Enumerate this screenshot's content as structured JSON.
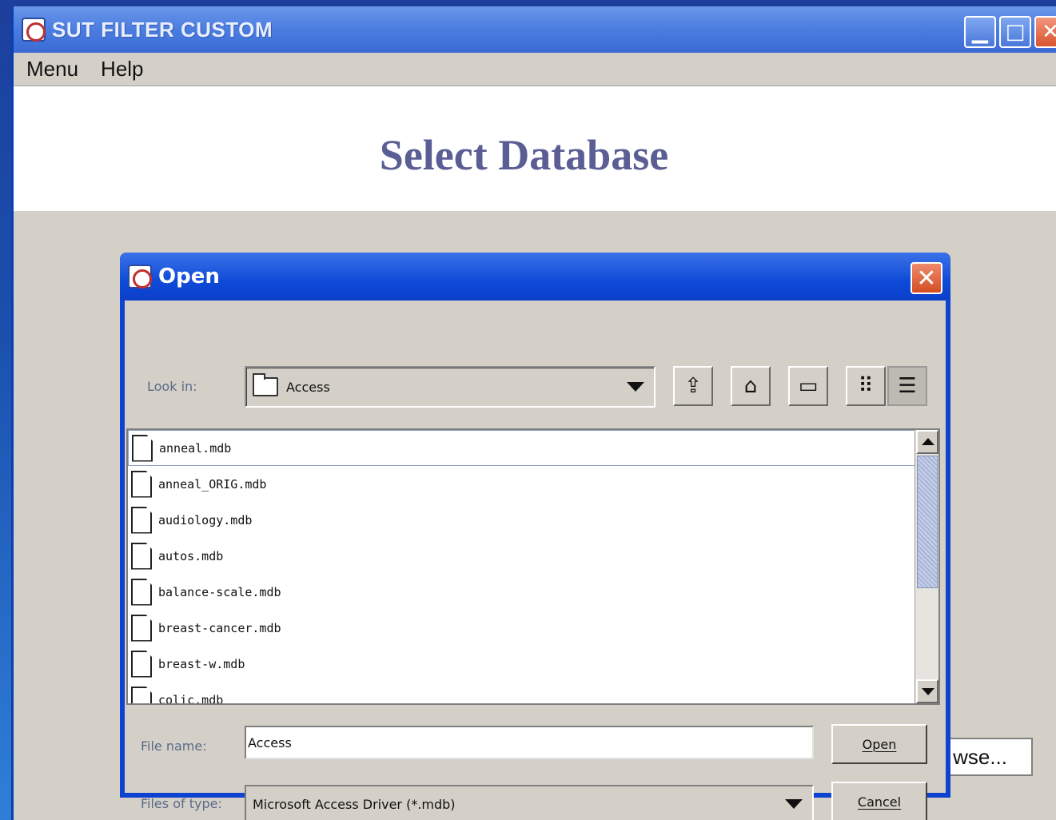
{
  "main_window": {
    "title": "SUT FILTER CUSTOM",
    "controls": {
      "minimize": "▁",
      "maximize": "□",
      "close": "✕"
    }
  },
  "menubar": {
    "items": [
      "Menu",
      "Help"
    ]
  },
  "page": {
    "title": "Select Database",
    "browse_button_partial": "wse..."
  },
  "dialog": {
    "title": "Open",
    "close": "✕",
    "look_in": {
      "label": "Look in:",
      "value": "Access"
    },
    "toolbar": {
      "icons": [
        "up-folder-icon",
        "home-icon",
        "new-folder-icon",
        "list-view-icon",
        "details-view-icon"
      ],
      "glyphs": {
        "up": "⇪",
        "home": "⌂",
        "new": "▭",
        "list": "⠿",
        "details": "☰"
      }
    },
    "files": [
      "anneal.mdb",
      "anneal_ORIG.mdb",
      "audiology.mdb",
      "autos.mdb",
      "balance-scale.mdb",
      "breast-cancer.mdb",
      "breast-w.mdb",
      "colic.mdb"
    ],
    "file_name": {
      "label": "File name:",
      "value": "Access"
    },
    "files_of_type": {
      "label": "Files of type:",
      "value": "Microsoft Access Driver (*.mdb)"
    },
    "buttons": {
      "open": "Open",
      "cancel": "Cancel"
    }
  },
  "colors": {
    "title_text": "#5b5e94",
    "dialog_frame": "#0d43d0",
    "window_bg": "#d4d0c8"
  }
}
